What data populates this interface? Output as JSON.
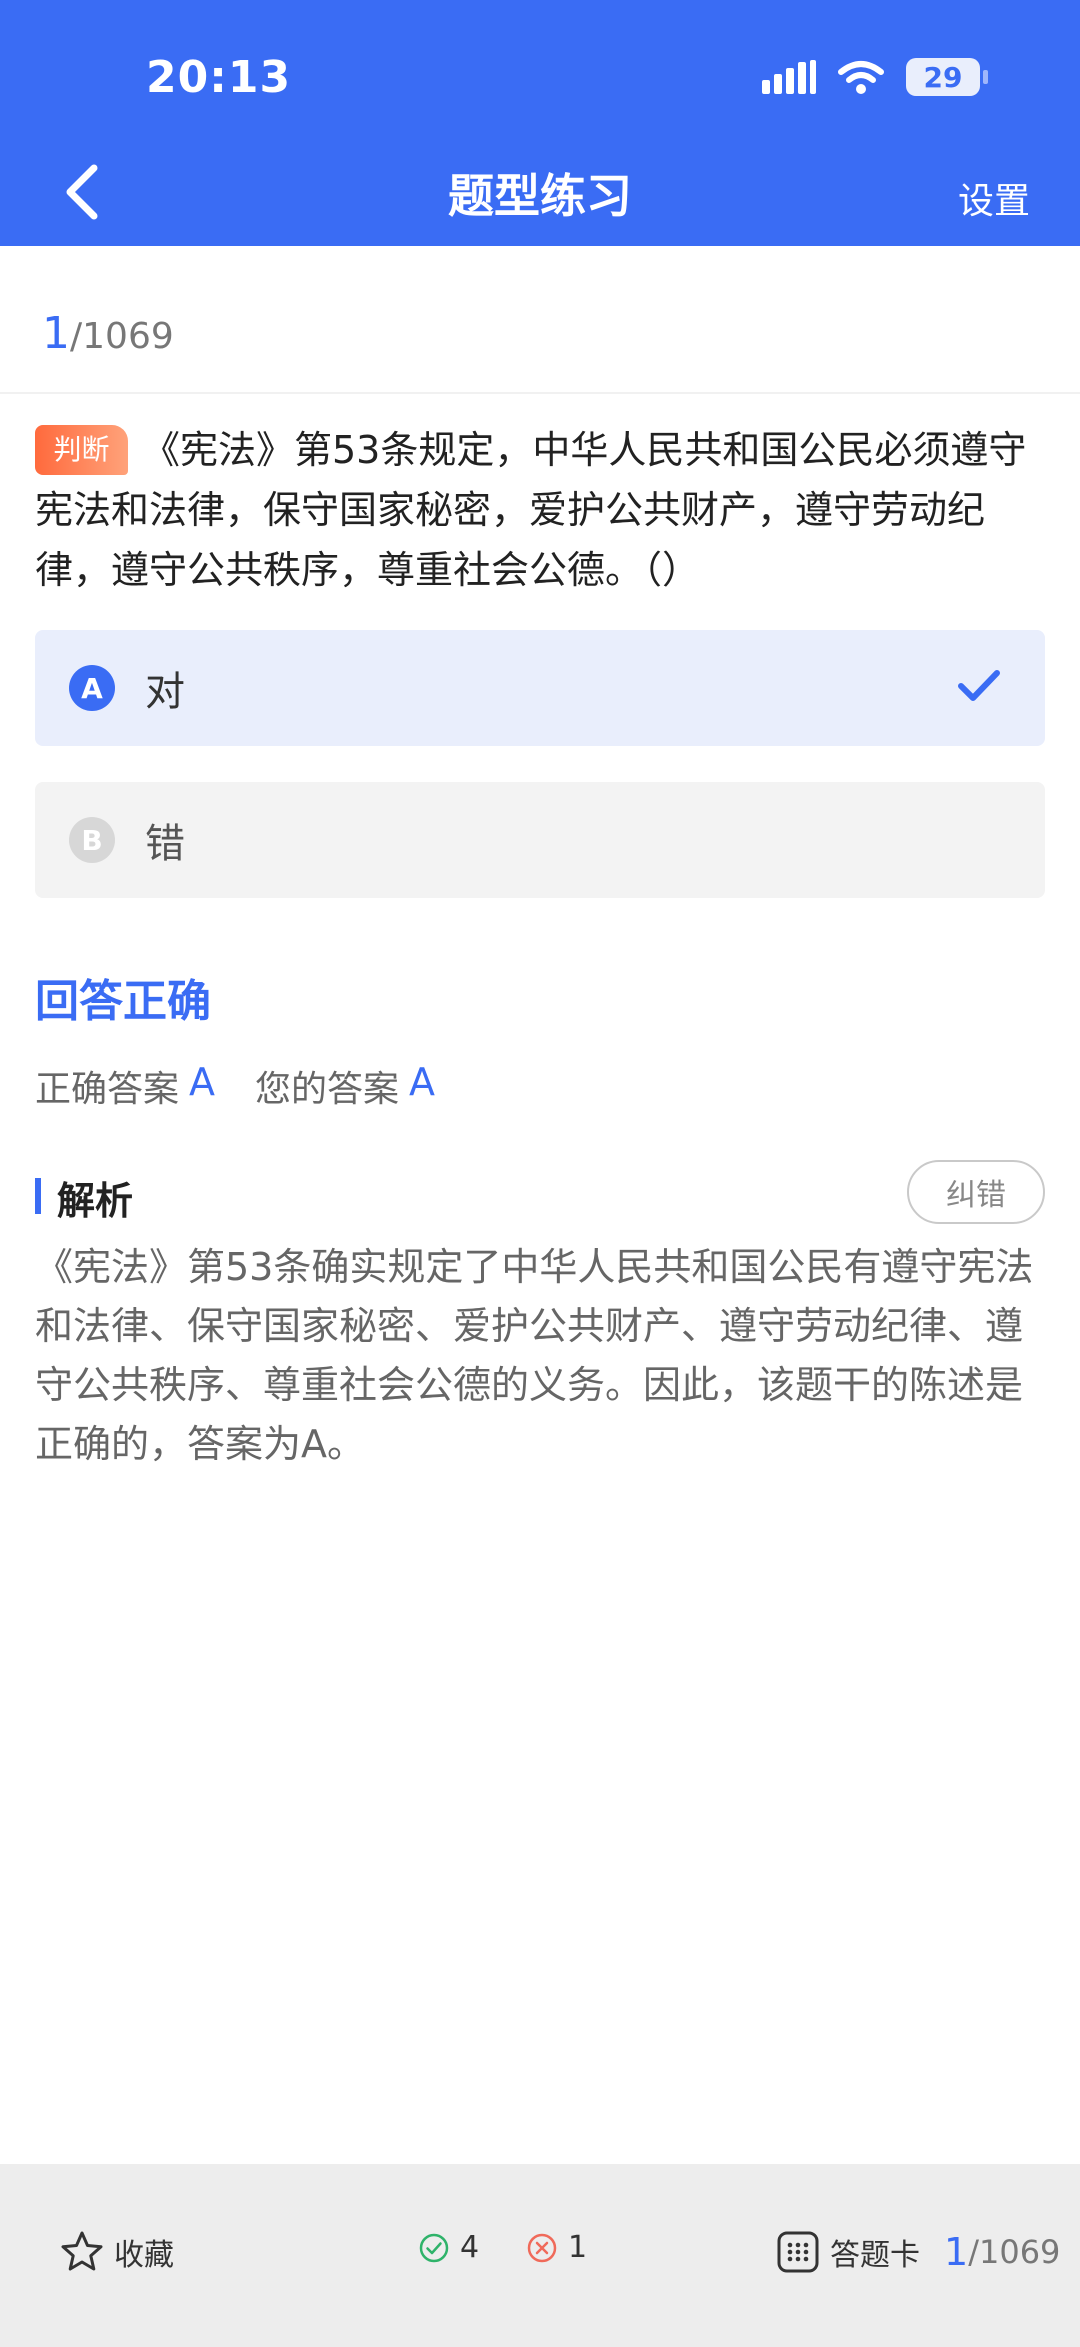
{
  "status": {
    "time": "20:13",
    "battery": "29"
  },
  "nav": {
    "title": "题型练习",
    "settings": "设置"
  },
  "progress": {
    "current": "1",
    "total": "/1069"
  },
  "question": {
    "tag": "判断",
    "text": "《宪法》第53条规定，中华人民共和国公民必须遵守宪法和法律，保守国家秘密，爱护公共财产，遵守劳动纪律，遵守公共秩序，尊重社会公德。（）"
  },
  "options": [
    {
      "letter": "A",
      "label": "对",
      "selected": true
    },
    {
      "letter": "B",
      "label": "错",
      "selected": false
    }
  ],
  "result": {
    "title": "回答正确",
    "correct_label": "正确答案",
    "correct_value": "A",
    "yours_label": "您的答案",
    "yours_value": "A"
  },
  "analysis": {
    "title": "解析",
    "fix_button": "纠错",
    "text": "《宪法》第53条确实规定了中华人民共和国公民有遵守宪法和法律、保守国家秘密、爱护公共财产、遵守劳动纪律、遵守公共秩序、尊重社会公德的义务。因此，该题干的陈述是正确的，答案为A。"
  },
  "footer": {
    "favorite": "收藏",
    "right_count": "4",
    "wrong_count": "1",
    "answer_card": "答题卡",
    "current": "1",
    "total": "/1069"
  },
  "colors": {
    "primary": "#3a6cf4",
    "tag": "#ff6a3d",
    "right": "#2fb36a",
    "wrong": "#f06a5a"
  }
}
